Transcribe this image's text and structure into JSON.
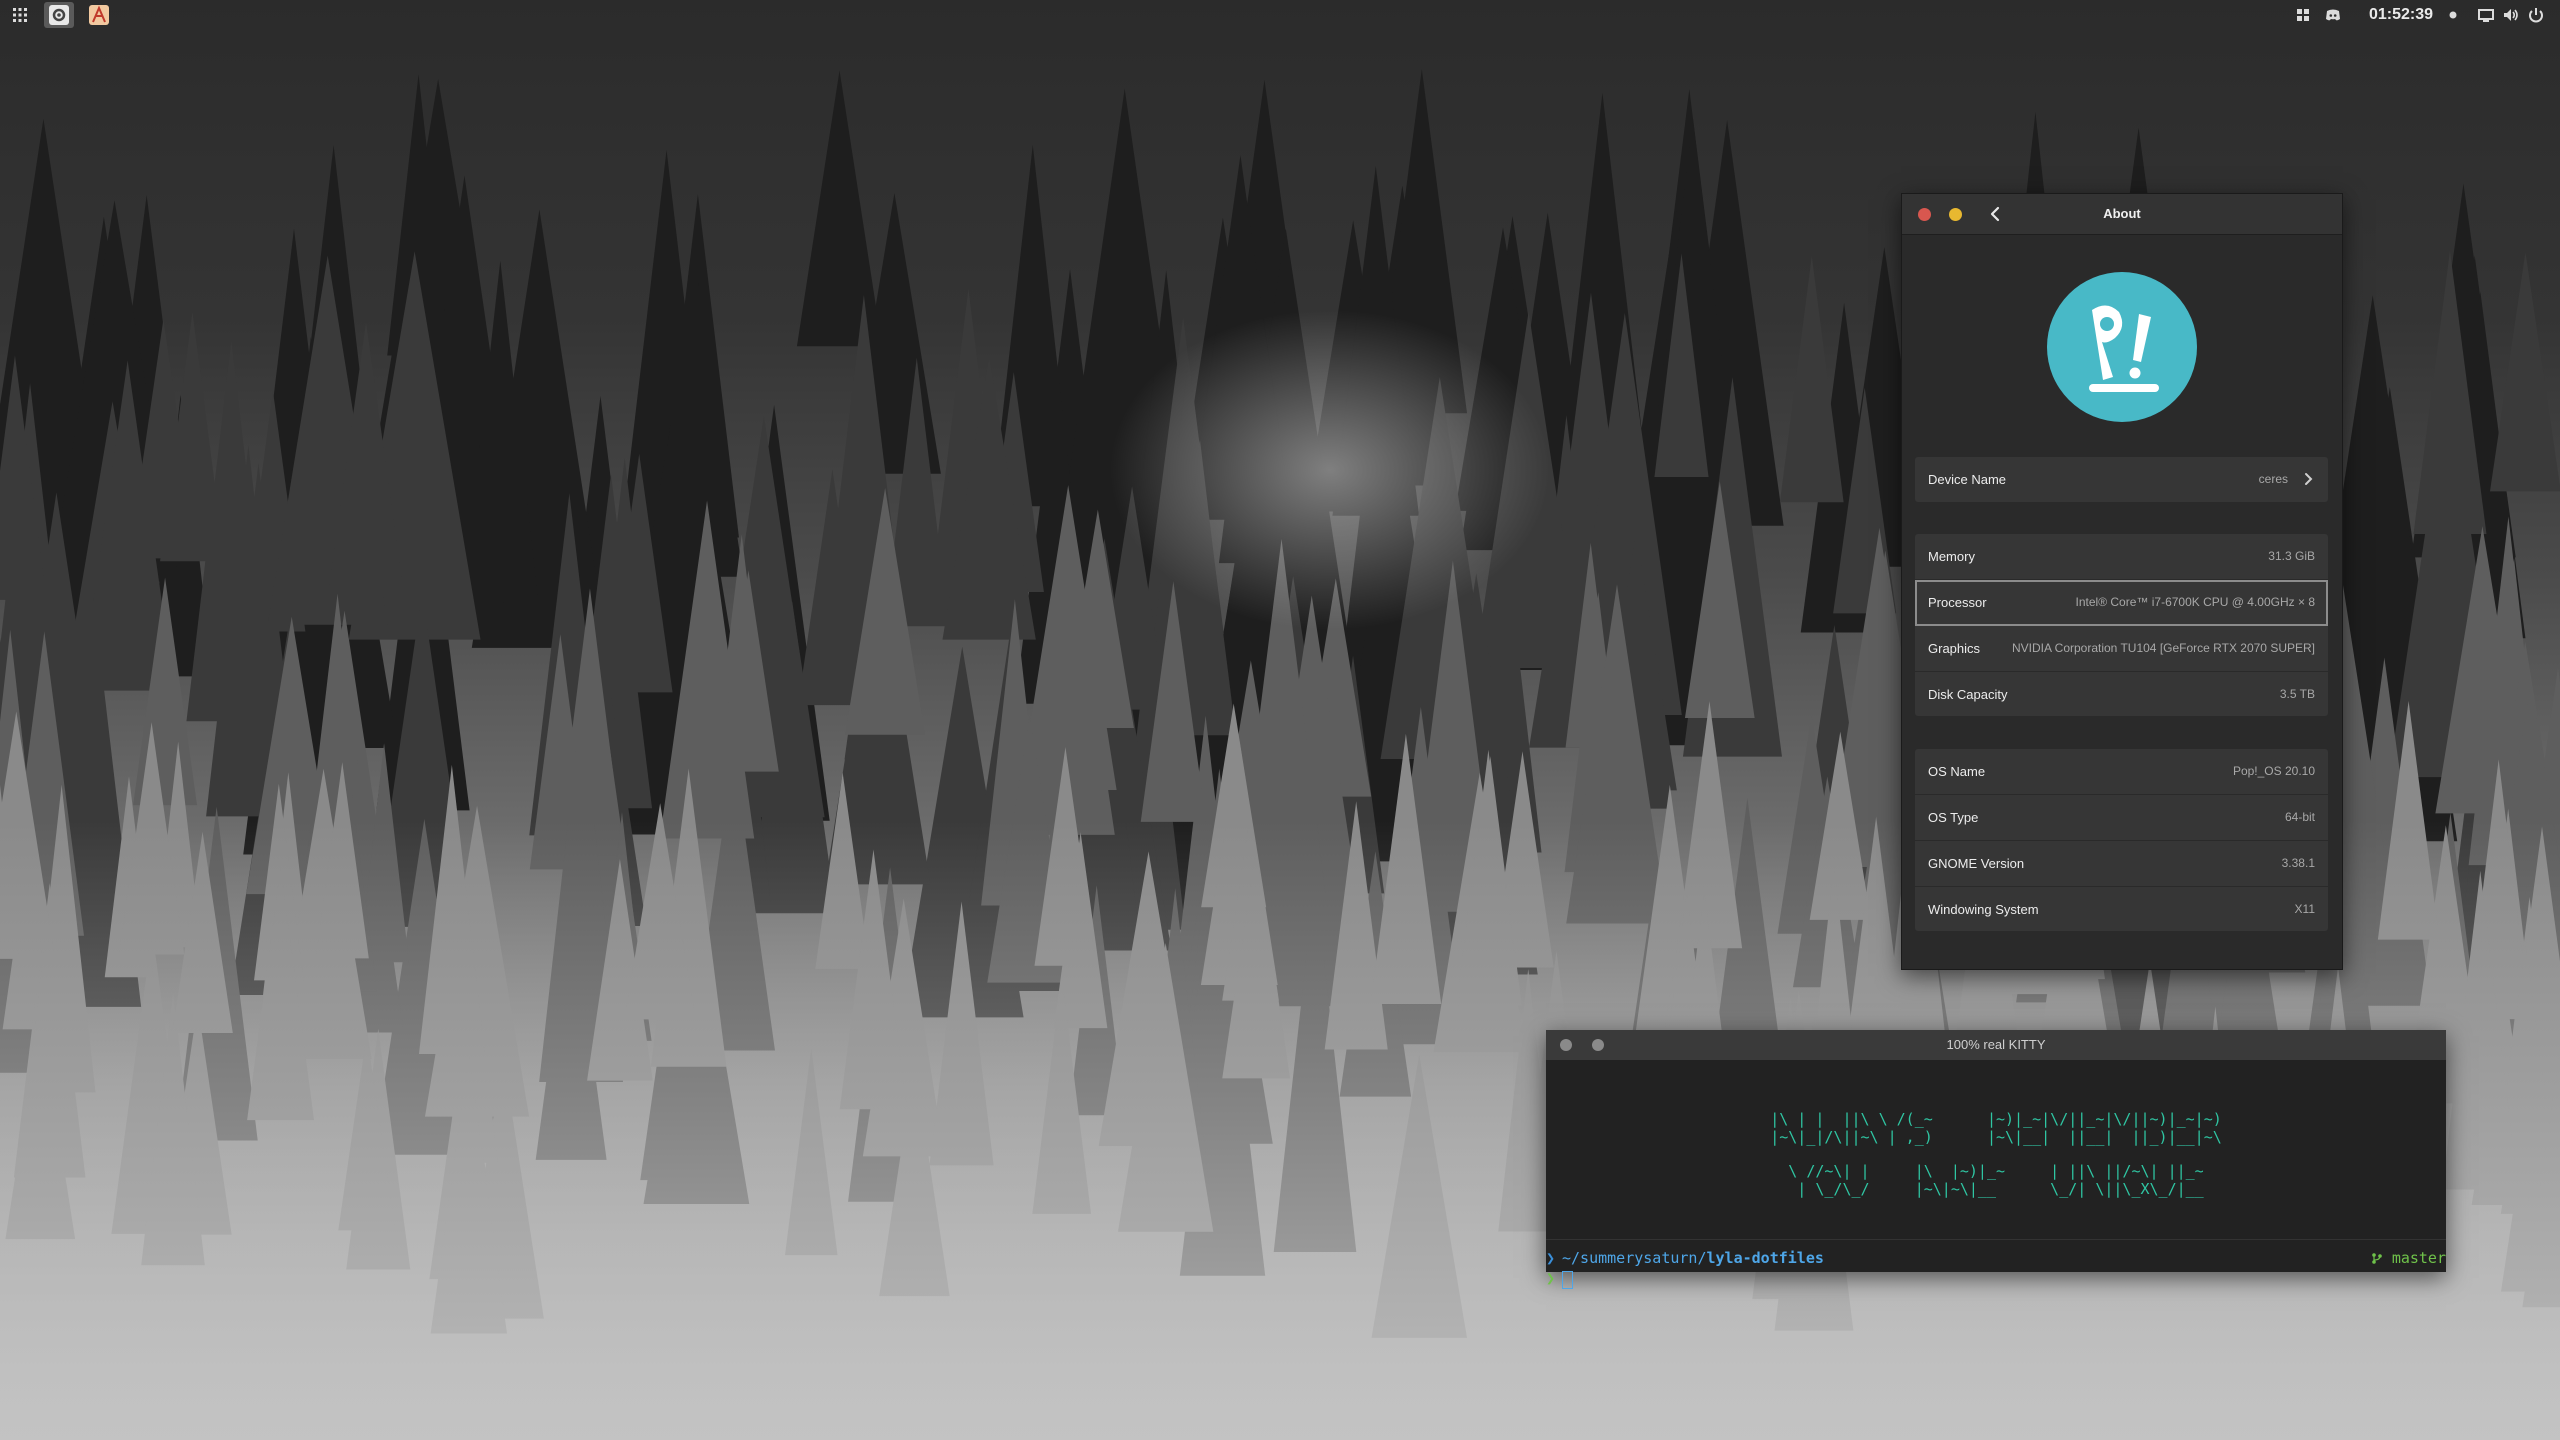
{
  "panel": {
    "clock": "01:52:39",
    "icons": [
      "apps-grid-icon",
      "settings-app-icon",
      "font-app-icon",
      "workspaces-icon",
      "discord-icon",
      "notification-dot-icon",
      "screen-icon",
      "volume-icon",
      "power-icon"
    ]
  },
  "about": {
    "title": "About",
    "device": {
      "label": "Device Name",
      "value": "ceres"
    },
    "hardware": [
      {
        "label": "Memory",
        "value": "31.3 GiB"
      },
      {
        "label": "Processor",
        "value": "Intel® Core™ i7-6700K CPU @ 4.00GHz × 8"
      },
      {
        "label": "Graphics",
        "value": "NVIDIA Corporation TU104 [GeForce RTX 2070 SUPER]"
      },
      {
        "label": "Disk Capacity",
        "value": "3.5 TB"
      }
    ],
    "os": [
      {
        "label": "OS Name",
        "value": "Pop!_OS 20.10"
      },
      {
        "label": "OS Type",
        "value": "64-bit"
      },
      {
        "label": "GNOME Version",
        "value": "3.38.1"
      },
      {
        "label": "Windowing System",
        "value": "X11"
      }
    ]
  },
  "terminal": {
    "title": "100% real KITTY",
    "banner": [
      "|\\ | |  ||\\ \\ /(_~      |~)|_~|\\/||_~|\\/||~)|_~|~)",
      "|~\\|_|/\\||~\\ | ,_)      |~\\|__|  ||__|  ||_)|__|~\\",
      "",
      "\\ //~\\| |     |\\  |~)|_~     | ||\\ ||/~\\| ||_~",
      " | \\_/\\_/     |~\\|~\\|__      \\_/| \\||\\_X\\_/|__"
    ],
    "prompt_arrow": "❯",
    "prompt_path": "~/summerysaturn/",
    "prompt_dir": "lyla-dotfiles",
    "git_branch": "master",
    "git_icon": "git-branch-icon",
    "cursor_arrow": "❯"
  },
  "colors": {
    "pop_logo": "#48b9c7",
    "terminal_banner": "#2fc6a3",
    "prompt_path": "#4ea6e8",
    "git": "#6fc24a",
    "close": "#d8574f",
    "minimize": "#e8b830"
  }
}
